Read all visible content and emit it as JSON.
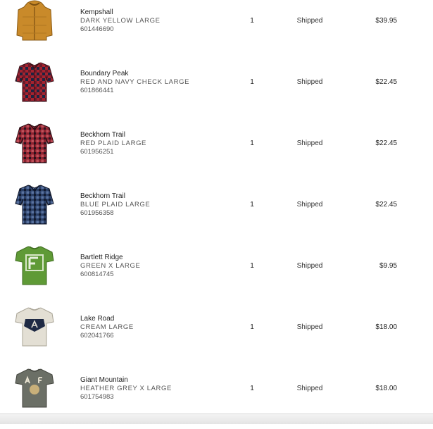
{
  "items": [
    {
      "name": "Kempshall",
      "variant": "DARK YELLOW LARGE",
      "sku": "601446690",
      "qty": "1",
      "status": "Shipped",
      "price": "$39.95",
      "icon": "yellow-jacket-icon",
      "color": "#c98a2a"
    },
    {
      "name": "Boundary Peak",
      "variant": "RED AND NAVY CHECK LARGE",
      "sku": "601866441",
      "qty": "1",
      "status": "Shipped",
      "price": "$22.45",
      "icon": "red-navy-shirt-icon",
      "color": "#a5232f"
    },
    {
      "name": "Beckhorn Trail",
      "variant": "RED PLAID LARGE",
      "sku": "601956251",
      "qty": "1",
      "status": "Shipped",
      "price": "$22.45",
      "icon": "red-plaid-shirt-icon",
      "color": "#8e2330"
    },
    {
      "name": "Beckhorn Trail",
      "variant": "BLUE PLAID LARGE",
      "sku": "601956358",
      "qty": "1",
      "status": "Shipped",
      "price": "$22.45",
      "icon": "blue-plaid-shirt-icon",
      "color": "#2a3f66"
    },
    {
      "name": "Bartlett Ridge",
      "variant": "GREEN X LARGE",
      "sku": "600814745",
      "qty": "1",
      "status": "Shipped",
      "price": "$9.95",
      "icon": "green-tshirt-icon",
      "color": "#5f9a36"
    },
    {
      "name": "Lake Road",
      "variant": "CREAM LARGE",
      "sku": "602041766",
      "qty": "1",
      "status": "Shipped",
      "price": "$18.00",
      "icon": "cream-tshirt-icon",
      "color": "#e3dfd4"
    },
    {
      "name": "Giant Mountain",
      "variant": "HEATHER GREY X LARGE",
      "sku": "601754983",
      "qty": "1",
      "status": "Shipped",
      "price": "$18.00",
      "icon": "grey-tshirt-icon",
      "color": "#6b6f66"
    }
  ]
}
